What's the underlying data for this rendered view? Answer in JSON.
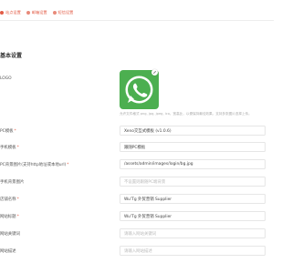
{
  "tabs": [
    {
      "label": "站点设置",
      "icon": "settings-icon",
      "active": true
    },
    {
      "label": "邮箱设置",
      "icon": "mail-icon",
      "active": false
    },
    {
      "label": "短信设置",
      "icon": "message-icon",
      "active": false
    }
  ],
  "section_title": "基本设置",
  "logo": {
    "label": "LOGO",
    "hint": "允许文件格式 png, jpg, jpeg, ico。宽高比，以便保持最佳效果。支持多张图片选择上传。"
  },
  "fields": [
    {
      "key": "pc_template",
      "label": "PC模板",
      "required": true,
      "value": "Xeno交互式模板 (v1.0.6)",
      "placeholder": ""
    },
    {
      "key": "mobile_template",
      "label": "手机模板",
      "required": true,
      "value": "跟随PC模板",
      "placeholder": ""
    },
    {
      "key": "pc_bg",
      "label": "PC背景图片(支持http地址或本地url)",
      "required": true,
      "value": "/assets/admin/images/login/bg.jpg",
      "placeholder": ""
    },
    {
      "key": "mobile_bg",
      "label": "手机背景图片",
      "required": false,
      "value": "",
      "placeholder": "不设置则跟随PC端背景"
    },
    {
      "key": "site_name",
      "label": "店铺名称",
      "required": true,
      "value": "Wu'Tg 外贸营销 Supplier",
      "placeholder": ""
    },
    {
      "key": "site_title",
      "label": "网站标题",
      "required": true,
      "value": "Wu'Tg 外贸营销 Supplier",
      "placeholder": ""
    },
    {
      "key": "keywords",
      "label": "网站关键词",
      "required": false,
      "value": "",
      "placeholder": "请输入网站关键词"
    },
    {
      "key": "description",
      "label": "网站描述",
      "required": false,
      "value": "",
      "placeholder": "请输入网站描述"
    }
  ],
  "colors": {
    "accent": "#e25b45",
    "logo_bg": "#4caf50"
  }
}
